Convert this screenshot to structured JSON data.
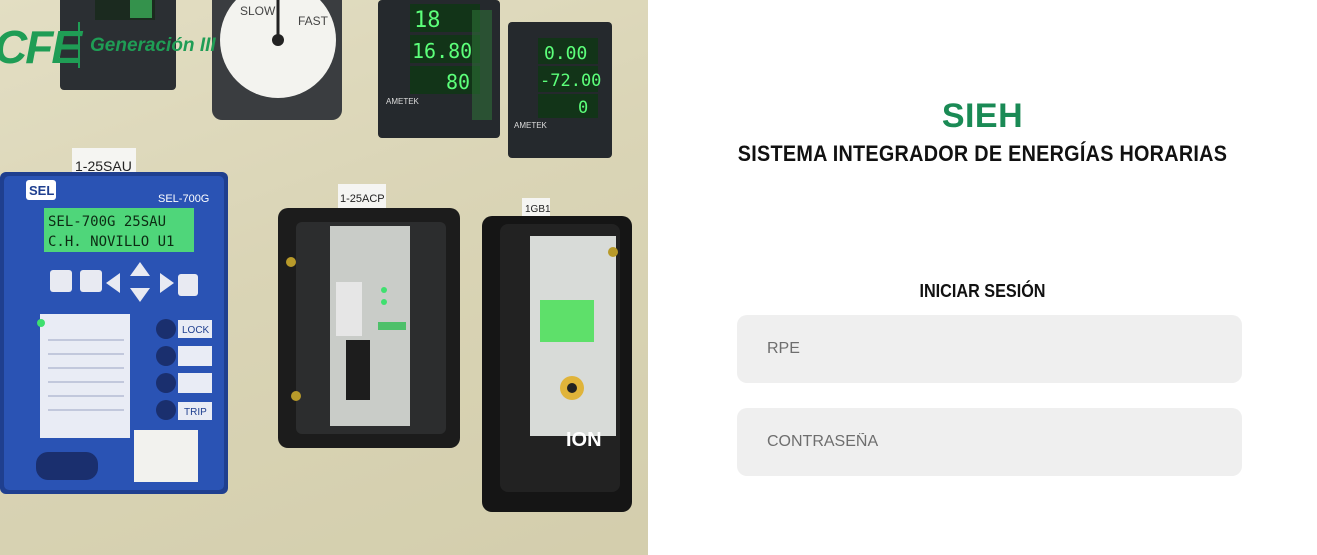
{
  "brand": {
    "logo_text": "CFE",
    "subtitle": "Generación III"
  },
  "login": {
    "app_title": "SIEH",
    "app_subtitle": "SISTEMA INTEGRADOR DE ENERGÍAS HORARIAS",
    "heading": "INICIAR SESIÓN",
    "rpe_placeholder": "RPE",
    "password_placeholder": "CONTRASEÑA"
  },
  "photo": {
    "tags": [
      "1-25SAU",
      "1-25ACP",
      "1GB1"
    ],
    "relay_brand": "SEL",
    "relay_model": "SEL-700G",
    "relay_display": [
      "SEL-700G 25SAU",
      "C.H. NOVILLO U1"
    ],
    "relay_buttons": [
      "LOCK",
      "TRIP"
    ],
    "sync_labels": [
      "SLOW",
      "FAST"
    ],
    "meter_a_readings": [
      "18",
      "16.80",
      "80"
    ],
    "meter_b_readings": [
      "0.00",
      "-72.00",
      "0"
    ],
    "meter_brand": "AMETEK",
    "ion_brand": "ION"
  }
}
